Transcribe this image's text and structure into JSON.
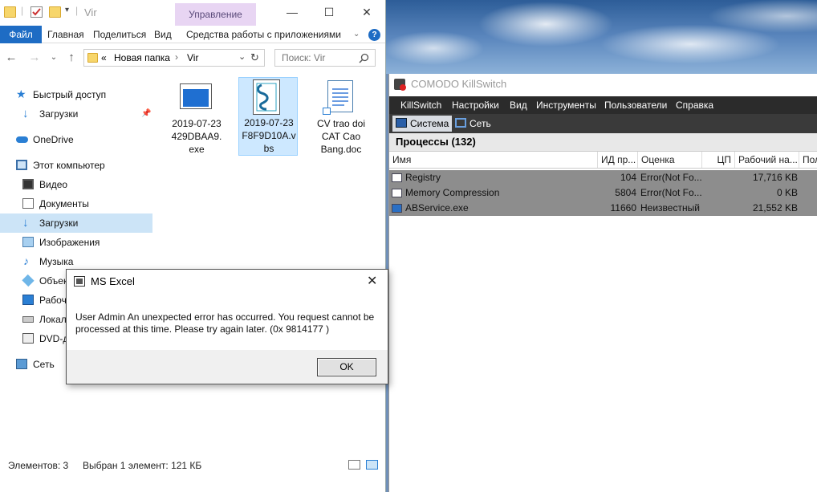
{
  "explorer": {
    "title": "Vir",
    "manage_tab": "Управление",
    "ribbon_tabs": [
      "Файл",
      "Главная",
      "Поделиться",
      "Вид",
      "Средства работы с приложениями"
    ],
    "address": {
      "prefix": "«",
      "segments": [
        "Новая папка",
        "Vir"
      ]
    },
    "search_placeholder": "Поиск: Vir",
    "nav": [
      {
        "label": "Быстрый доступ",
        "icon": "star-icon"
      },
      {
        "label": "Загрузки",
        "icon": "download-icon"
      },
      {
        "label": "OneDrive",
        "icon": "cloud-icon"
      },
      {
        "label": "Этот компьютер",
        "icon": "computer-icon"
      },
      {
        "label": "Видео",
        "icon": "video-icon"
      },
      {
        "label": "Документы",
        "icon": "documents-icon"
      },
      {
        "label": "Загрузки",
        "icon": "download-icon"
      },
      {
        "label": "Изображения",
        "icon": "pictures-icon"
      },
      {
        "label": "Музыка",
        "icon": "music-icon"
      },
      {
        "label": "Объек",
        "icon": "3d-objects-icon"
      },
      {
        "label": "Рабоч",
        "icon": "desktop-icon"
      },
      {
        "label": "Локал",
        "icon": "drive-icon"
      },
      {
        "label": "DVD-д",
        "icon": "dvd-icon"
      },
      {
        "label": "Сеть",
        "icon": "network-icon"
      }
    ],
    "files": [
      {
        "name": "2019-07-23\n429DBAA9.\nexe",
        "icon": "exe-icon"
      },
      {
        "name": "2019-07-23\nF8F9D10A.v\nbs",
        "icon": "vbs-script-icon"
      },
      {
        "name": "CV trao doi\nCAT Cao\nBang.doc",
        "icon": "doc-icon"
      }
    ],
    "status": {
      "count": "Элементов: 3",
      "selected": "Выбран 1 элемент: 121 КБ"
    }
  },
  "comodo": {
    "title": "COMODO KillSwitch",
    "menu": [
      "KillSwitch",
      "Настройки",
      "Вид",
      "Инструменты",
      "Пользователи",
      "Справка"
    ],
    "tabs": [
      "Система",
      "Сеть"
    ],
    "processes_header": "Процессы (132)",
    "columns": [
      "Имя",
      "ИД пр...",
      "Оценка",
      "ЦП",
      "Рабочий на...",
      "Пол"
    ],
    "rows": [
      {
        "name": "Registry",
        "pid": "104",
        "rating": "Error(Not Fo...",
        "cpu": "",
        "ws": "17,716 KB"
      },
      {
        "name": "Memory Compression",
        "pid": "5804",
        "rating": "Error(Not Fo...",
        "cpu": "",
        "ws": "0 KB"
      },
      {
        "name": "ABService.exe",
        "pid": "11660",
        "rating": "Неизвестный",
        "cpu": "",
        "ws": "21,552 KB"
      }
    ]
  },
  "dialog": {
    "title": "MS Excel",
    "message": "User Admin An unexpected error has occurred. You request cannot be processed at this time. Please try again later. (0x 9814177 )",
    "ok_label": "OK"
  },
  "colors": {
    "accent": "#1e6cc4",
    "manage_tab": "#e8d5f3",
    "selection": "#cce4f7",
    "comodo_menu": "#2b2b2b",
    "process_row": "#8d8d8d"
  }
}
